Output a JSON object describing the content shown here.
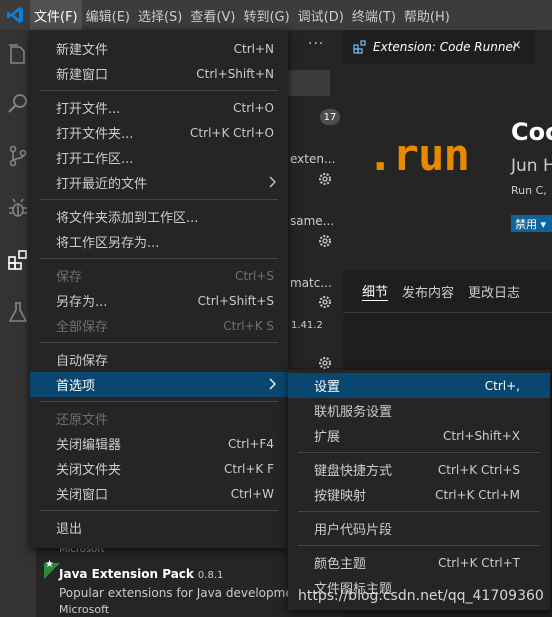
{
  "menubar": {
    "items": [
      "文件(F)",
      "编辑(E)",
      "选择(S)",
      "查看(V)",
      "转到(G)",
      "调试(D)",
      "终端(T)",
      "帮助(H)"
    ]
  },
  "file_menu": {
    "groups": [
      [
        {
          "label": "新建文件",
          "shortcut": "Ctrl+N"
        },
        {
          "label": "新建窗口",
          "shortcut": "Ctrl+Shift+N"
        }
      ],
      [
        {
          "label": "打开文件...",
          "shortcut": "Ctrl+O"
        },
        {
          "label": "打开文件夹...",
          "shortcut": "Ctrl+K Ctrl+O"
        },
        {
          "label": "打开工作区..."
        },
        {
          "label": "打开最近的文件",
          "has_submenu": true
        }
      ],
      [
        {
          "label": "将文件夹添加到工作区..."
        },
        {
          "label": "将工作区另存为..."
        }
      ],
      [
        {
          "label": "保存",
          "shortcut": "Ctrl+S",
          "disabled": true
        },
        {
          "label": "另存为...",
          "shortcut": "Ctrl+Shift+S"
        },
        {
          "label": "全部保存",
          "shortcut": "Ctrl+K S",
          "disabled": true
        }
      ],
      [
        {
          "label": "自动保存"
        },
        {
          "label": "首选项",
          "has_submenu": true,
          "selected": true
        }
      ],
      [
        {
          "label": "还原文件",
          "disabled": true
        },
        {
          "label": "关闭编辑器",
          "shortcut": "Ctrl+F4"
        },
        {
          "label": "关闭文件夹",
          "shortcut": "Ctrl+K F"
        },
        {
          "label": "关闭窗口",
          "shortcut": "Ctrl+W"
        }
      ],
      [
        {
          "label": "退出"
        }
      ]
    ]
  },
  "preferences_submenu": {
    "groups": [
      [
        {
          "label": "设置",
          "shortcut": "Ctrl+,",
          "selected": true
        },
        {
          "label": "联机服务设置"
        },
        {
          "label": "扩展",
          "shortcut": "Ctrl+Shift+X"
        }
      ],
      [
        {
          "label": "键盘快捷方式",
          "shortcut": "Ctrl+K Ctrl+S"
        },
        {
          "label": "按键映射",
          "shortcut": "Ctrl+K Ctrl+M"
        }
      ],
      [
        {
          "label": "用户代码片段"
        }
      ],
      [
        {
          "label": "颜色主题",
          "shortcut": "Ctrl+K Ctrl+T"
        },
        {
          "label": "文件图标主题"
        }
      ]
    ]
  },
  "sidebar": {
    "more_label": "···",
    "installed_count": "17",
    "fragments": {
      "f1": "exten...",
      "f2": "same...",
      "f3": "matc...",
      "f4": "1.41.2"
    },
    "prev_publisher": "Microsoft",
    "extension": {
      "title": "Java Extension Pack",
      "version": "0.8.1",
      "description": "Popular extensions for Java development",
      "publisher": "Microsoft"
    }
  },
  "editor": {
    "tab_title": "Extension: Code Runner",
    "tab_close": "×",
    "logo_text": ".run",
    "name": "Coc",
    "author": "Jun H",
    "short_desc": "Run C,",
    "disable_label": "禁用 ▾",
    "detail_tabs": [
      "细节",
      "发布内容",
      "更改日志"
    ]
  },
  "watermark": "https://blog.csdn.net/qq_41709360",
  "colors": {
    "menu_bg": "#252526",
    "menu_selected": "#094771",
    "logo_orange": "#e88a00",
    "vscode_blue": "#0e7ed6",
    "button_blue": "#0e639c"
  }
}
